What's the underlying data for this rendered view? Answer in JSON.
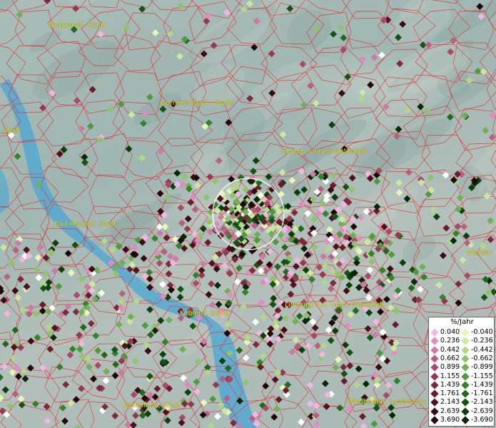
{
  "legend": {
    "title": "%/Jahr",
    "positive": [
      "0.040",
      "0.236",
      "0.442",
      "0.662",
      "0.899",
      "1.155",
      "1.439",
      "1.761",
      "2.143",
      "2.639",
      "3.690"
    ],
    "negative": [
      "-0.040",
      "-0.236",
      "-0.442",
      "-0.662",
      "-0.899",
      "-1.155",
      "-1.439",
      "-1.761",
      "-2.143",
      "-2.639",
      "-3.690"
    ],
    "positive_colors": [
      "#f2b6e0",
      "#e08cc0",
      "#cc7aa6",
      "#b8607f",
      "#a84a68",
      "#96384f",
      "#7e2a3c",
      "#6a1c2c",
      "#52101e",
      "#3c0a12",
      "#200408"
    ],
    "negative_colors": [
      "#e6f5b8",
      "#cce8a0",
      "#b0d888",
      "#8ec46c",
      "#70b054",
      "#4e9a3c",
      "#34822a",
      "#206a1c",
      "#145412",
      "#0a400a",
      "#042a04"
    ]
  },
  "cities": [
    {
      "id": "wuppertal",
      "label": "Wuppertal, Stadt"
    },
    {
      "id": "gummersbach",
      "label": "Gummersbach, Stadt"
    },
    {
      "id": "stadt-left",
      "label": "Stadt"
    },
    {
      "id": "siegen",
      "label": "Siegen, Universitätsstadt"
    },
    {
      "id": "bad-honnef",
      "label": "Bad Honnef, Stadt"
    },
    {
      "id": "wetzlar",
      "label": "Wetzlar"
    },
    {
      "id": "limburg",
      "label": "Limburg a.d. Lahn, Kreisstadt"
    },
    {
      "id": "koblenz",
      "label": "Koblenz, Stadt"
    },
    {
      "id": "kastellaun",
      "label": "Kastellaun, Stadt"
    },
    {
      "id": "wiesbaden",
      "label": "Wiesbaden, Landeshau"
    }
  ],
  "colors": {
    "border": "#e03030",
    "river": "#4aa6d6",
    "label": "#e8e23a",
    "highlight_circle": "#ffffff"
  }
}
